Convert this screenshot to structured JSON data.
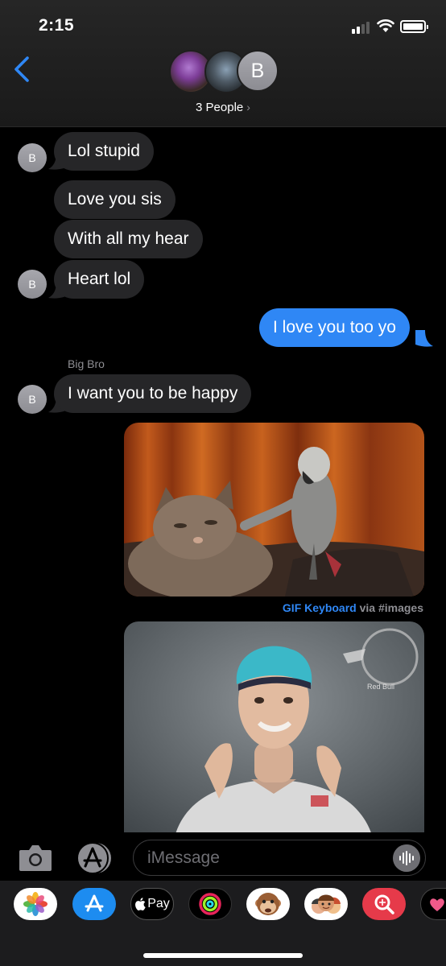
{
  "status_bar": {
    "time": "2:15"
  },
  "header": {
    "group_initial": "B",
    "group_name": "3 People",
    "chevron": "›"
  },
  "messages": {
    "m1": {
      "avatar_initial": "B",
      "text": "Lol stupid"
    },
    "m2": {
      "text": "Love you sis"
    },
    "m3": {
      "text": "With all my hear"
    },
    "m4": {
      "avatar_initial": "B",
      "text": "Heart lol"
    },
    "m5": {
      "text": "I love you too yo"
    },
    "sender": "Big Bro",
    "m6": {
      "avatar_initial": "B",
      "text": "I want you to be happy"
    },
    "gif_caption": {
      "link": "GIF Keyboard",
      "suffix": "via #images"
    },
    "gif2_logo": "Red Bull"
  },
  "input": {
    "placeholder": "iMessage"
  },
  "app_drawer": {
    "apple_pay_label": "Pay",
    "apps": [
      "photos-icon",
      "app-store-icon",
      "apple-pay-icon",
      "activity-icon",
      "animoji-icon",
      "memoji-icon",
      "images-search-icon",
      "heart-app-icon"
    ]
  },
  "colors": {
    "outgoing_bubble": "#2f87f5",
    "incoming_bubble": "#262628",
    "link": "#2f87f5",
    "secondary_text": "#8e8e93"
  }
}
